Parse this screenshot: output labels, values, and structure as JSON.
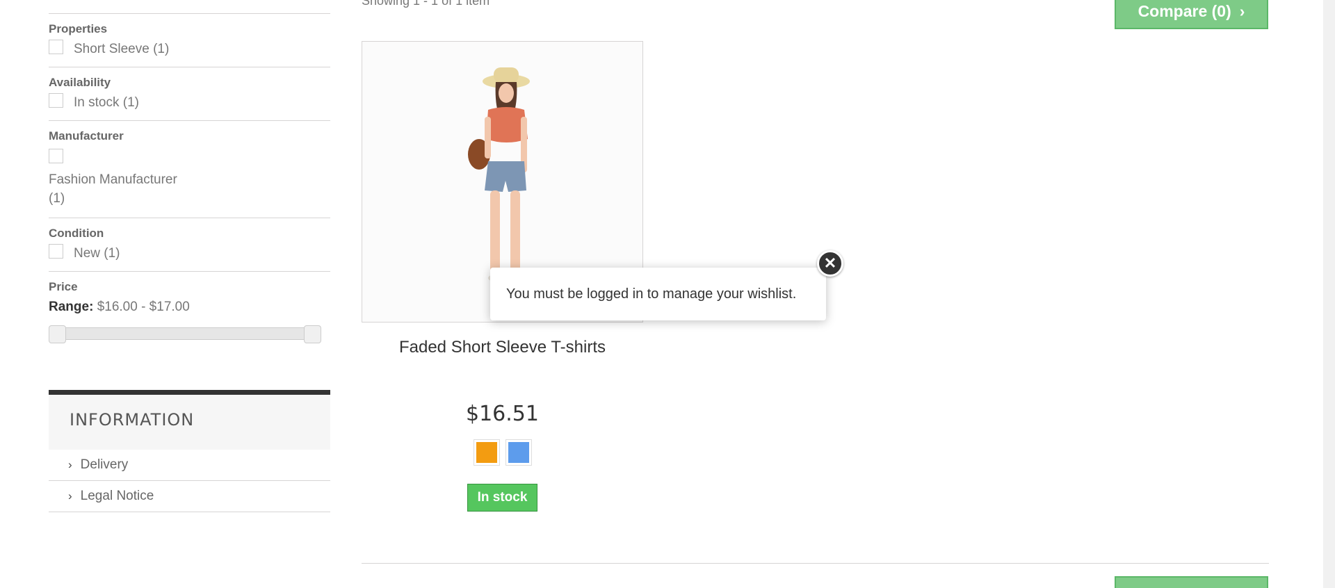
{
  "filters": {
    "properties": {
      "title": "Properties",
      "option": "Short Sleeve (1)"
    },
    "availability": {
      "title": "Availability",
      "option": "In stock (1)"
    },
    "manufacturer": {
      "title": "Manufacturer",
      "option": "Fashion Manufacturer (1)"
    },
    "condition": {
      "title": "Condition",
      "option": "New (1)"
    },
    "price": {
      "title": "Price",
      "range_label": "Range:",
      "range_value": "$16.00 - $17.00"
    }
  },
  "information": {
    "title": "INFORMATION",
    "items": [
      "Delivery",
      "Legal Notice"
    ]
  },
  "listing": {
    "showing": "Showing 1 - 1 of 1 item",
    "compare_label": "Compare (0)"
  },
  "product": {
    "name": "Faded Short Sleeve T-shirts",
    "price": "$16.51",
    "availability": "In stock",
    "colors": [
      "#f39c11",
      "#5d9cec"
    ]
  },
  "modal": {
    "message": "You must be logged in to manage your wishlist."
  }
}
